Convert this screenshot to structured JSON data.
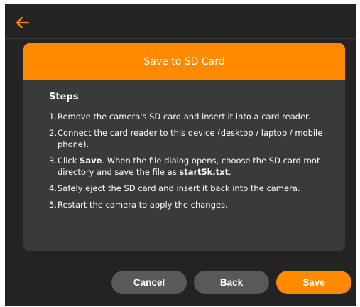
{
  "header": {
    "back_icon": "arrow-left-icon",
    "accent_color": "#ff8a00"
  },
  "dialog": {
    "title": "Save to SD Card",
    "steps_title": "Steps",
    "steps": [
      {
        "number": "1.",
        "text": "Remove the camera's SD card and insert it into a card reader."
      },
      {
        "number": "2.",
        "text": "Connect the card reader to this device (desktop / laptop / mobile phone)."
      },
      {
        "number": "3.",
        "prefix": "Click ",
        "bold1": "Save",
        "middle": ". When the file dialog opens, choose the SD card root directory and save the file as ",
        "bold2": "start5k.txt",
        "suffix": "."
      },
      {
        "number": "4.",
        "text": "Safely eject the SD card and insert it back into the camera."
      },
      {
        "number": "5.",
        "text": "Restart the camera to apply the changes."
      }
    ]
  },
  "footer": {
    "cancel_label": "Cancel",
    "back_label": "Back",
    "save_label": "Save"
  }
}
